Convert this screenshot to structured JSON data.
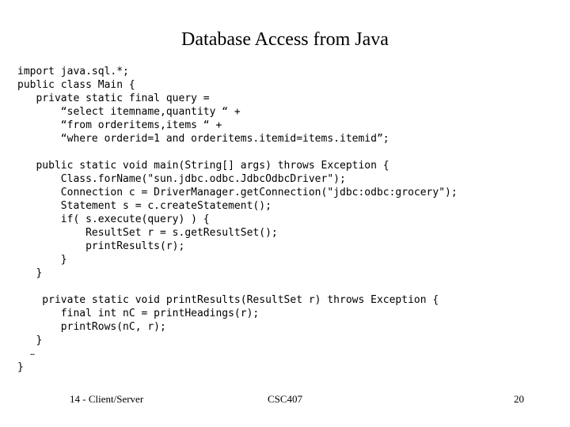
{
  "slide": {
    "title": "Database Access from Java",
    "code_lines": [
      "import java.sql.*;",
      "public class Main {",
      "   private static final query =",
      "       “select itemname,quantity “ +",
      "       “from orderitems,items “ +",
      "       “where orderid=1 and orderitems.itemid=items.itemid”;",
      "",
      "   public static void main(String[] args) throws Exception {",
      "       Class.forName(\"sun.jdbc.odbc.JdbcOdbcDriver\");",
      "       Connection c = DriverManager.getConnection(\"jdbc:odbc:grocery\");",
      "       Statement s = c.createStatement();",
      "       if( s.execute(query) ) {",
      "           ResultSet r = s.getResultSet();",
      "           printResults(r);",
      "       }",
      "   }",
      "",
      "    private static void printResults(ResultSet r) throws Exception {",
      "       final int nC = printHeadings(r);",
      "       printRows(nC, r);",
      "   }",
      "   …",
      "}"
    ],
    "footer": {
      "left": "14 - Client/Server",
      "center": "CSC407",
      "right": "20"
    },
    "colors": {
      "background": "#ffffff",
      "text": "#000000"
    }
  }
}
